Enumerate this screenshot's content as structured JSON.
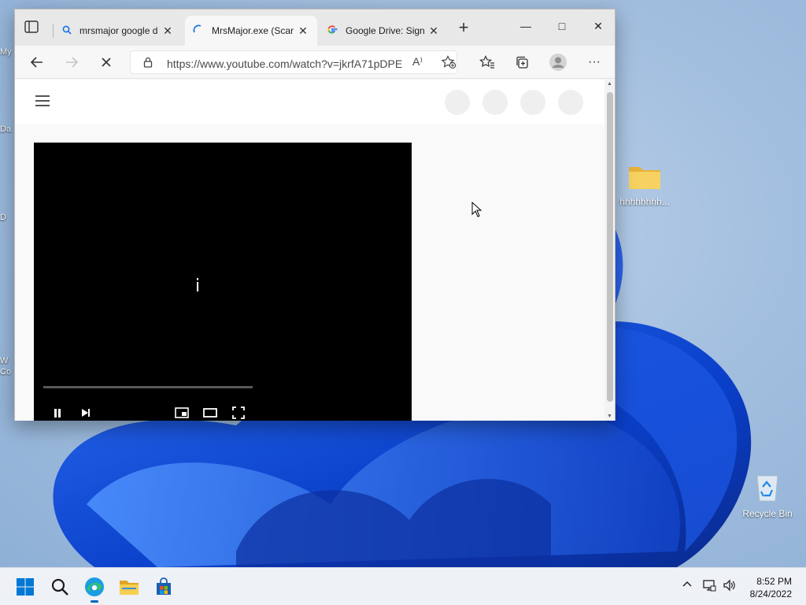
{
  "browser": {
    "tabs": [
      {
        "title": "mrsmajor google d",
        "icon": "search-icon",
        "active": false
      },
      {
        "title": "MrsMajor.exe (Scar",
        "icon": "loading-icon",
        "active": true
      },
      {
        "title": "Google Drive: Sign",
        "icon": "google-icon",
        "active": false
      }
    ],
    "new_tab_label": "+",
    "address": {
      "url": "https://www.youtube.com/watch?v=jkrfA71pDPE",
      "read_aloud": "A⁾"
    },
    "window_controls": {
      "minimize": "—",
      "maximize": "□",
      "close": "✕"
    }
  },
  "player": {
    "center_glyph": "ı̇",
    "progress": 0.0,
    "controls": [
      "pause-icon",
      "next-icon",
      "miniplayer-icon",
      "theater-icon",
      "fullscreen-icon"
    ]
  },
  "desktop": {
    "icons": [
      {
        "label": "hhhhhhhh...",
        "icon": "folder-icon"
      },
      {
        "label": "Recycle Bin",
        "icon": "recycle-bin-icon"
      }
    ],
    "left_edge_labels": [
      "My",
      "Da",
      "D",
      "W",
      "Co"
    ]
  },
  "taskbar": {
    "apps": [
      "start-icon",
      "search-icon",
      "edge-icon",
      "file-explorer-icon",
      "store-icon"
    ],
    "clock": {
      "time": "8:52 PM",
      "date": "8/24/2022"
    }
  },
  "colors": {
    "accent": "#0067c0",
    "folder": "#f2c94c",
    "player_bg": "#000000"
  }
}
